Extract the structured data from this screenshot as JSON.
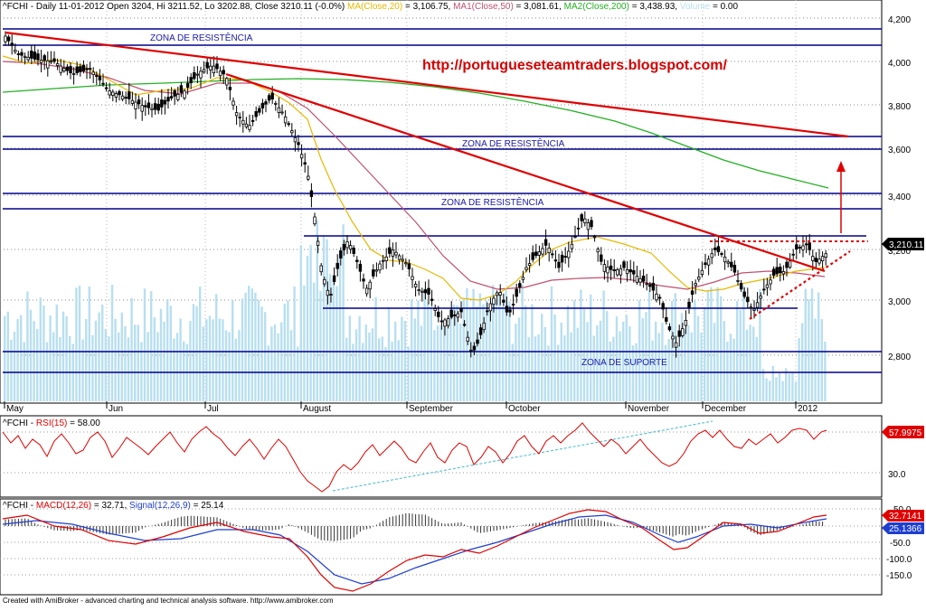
{
  "header": {
    "symbol": "^FCHI",
    "summary": " - Daily 11-01-2012 Open 3204, Hi 3211.52, Lo 3202.88, Close 3210.11 (-0.0%) ",
    "ma20_label": "MA(Close,20)",
    "ma20_value": " = 3,106.75, ",
    "ma50_label": "MA1(Close,50)",
    "ma50_value": " = 3,081.61, ",
    "ma200_label": "MA2(Close,200)",
    "ma200_value": " = 3,438.93, ",
    "volume_label": "Volume",
    "volume_value": " = 0.00"
  },
  "url_text": "http://portugueseteamtraders.blogspot.com/",
  "zones": {
    "resistance_1": "ZONA DE RESISTÊNCIA",
    "resistance_2": "ZONA DE RESISTÊNCIA",
    "resistance_3": "ZONA DE RESISTÊNCIA",
    "support": "ZONA DE SUPORTE"
  },
  "price_axis": [
    "4,200",
    "4,000",
    "3,800",
    "3,600",
    "3,400",
    "3,200",
    "3,000",
    "2,800"
  ],
  "last_close_label": "3,210.11",
  "months": [
    "May",
    "Jun",
    "Jul",
    "August",
    "September",
    "October",
    "November",
    "December",
    "2012"
  ],
  "rsi": {
    "header_symbol": "^FCHI",
    "header_sep": " - ",
    "label": "RSI(15)",
    "value": " = 58.00",
    "axis_label": "30.0",
    "last_label": "57.9975"
  },
  "macd": {
    "header_symbol": "^FCHI",
    "header_sep": " - ",
    "label": "MACD(12,26)",
    "value": " = 32.71, ",
    "signal_label": "Signal(12,26,9)",
    "signal_value": " = 25.14",
    "axis_labels": [
      "50.0",
      "-50.0",
      "-100.0",
      "-150.0"
    ],
    "macd_last_label": "32.7141",
    "signal_last_label": "25.1366"
  },
  "footer": "Created with AmiBroker - advanced charting and technical analysis software. http://www.amibroker.com",
  "colors": {
    "ma20": "#e8b800",
    "ma50": "#c0506e",
    "ma200": "#22b022",
    "trendline": "#e00000",
    "zone": "#00008b",
    "volume": "#b8dff0",
    "rsi": "#e00000",
    "macd": "#e00000",
    "signal": "#1f3fd0"
  },
  "chart_data": [
    {
      "type": "candlestick",
      "title": "^FCHI Daily",
      "x_labels": [
        "May",
        "Jun",
        "Jul",
        "August",
        "September",
        "October",
        "November",
        "December",
        "2012"
      ],
      "ylim": [
        2650,
        4230
      ],
      "y_ticks": [
        4200,
        4000,
        3800,
        3600,
        3400,
        3200,
        3000,
        2800
      ],
      "ohlc": {
        "open": 3204,
        "high": 3211.52,
        "low": 3202.88,
        "close": 3210.11
      },
      "close_path": [
        [
          "May",
          4100
        ],
        [
          "May",
          3990
        ],
        [
          "Jun",
          3930
        ],
        [
          "Jun",
          3800
        ],
        [
          "Jul",
          3760
        ],
        [
          "Jul",
          4000
        ],
        [
          "Jul",
          3700
        ],
        [
          "August",
          3300
        ],
        [
          "August",
          3050
        ],
        [
          "September",
          3150
        ],
        [
          "September",
          2800
        ],
        [
          "October",
          3000
        ],
        [
          "October",
          3300
        ],
        [
          "November",
          3100
        ],
        [
          "November",
          2850
        ],
        [
          "December",
          3150
        ],
        [
          "December",
          2990
        ],
        [
          "2012",
          3200
        ]
      ],
      "moving_averages": [
        {
          "name": "MA(Close,20)",
          "last": 3106.75
        },
        {
          "name": "MA1(Close,50)",
          "last": 3081.61
        },
        {
          "name": "MA2(Close,200)",
          "last": 3438.93
        }
      ]
    },
    {
      "type": "line",
      "title": "RSI(15)",
      "last": 58.0,
      "axis_tick": 30.0
    },
    {
      "type": "line",
      "title": "MACD(12,26)",
      "series": [
        {
          "name": "MACD(12,26)",
          "last": 32.71
        },
        {
          "name": "Signal(12,26,9)",
          "last": 25.14
        }
      ],
      "y_ticks": [
        50,
        -50,
        -100,
        -150
      ]
    }
  ]
}
